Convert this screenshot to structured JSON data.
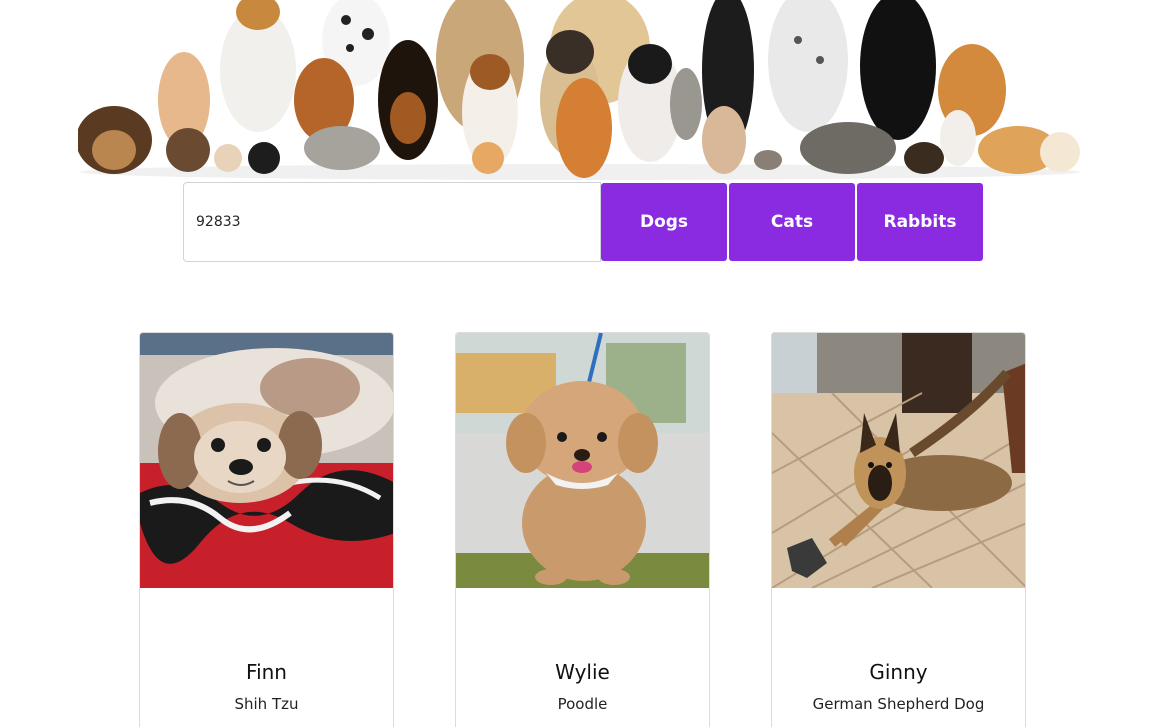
{
  "hero": {
    "image": "group-of-pets-illustration"
  },
  "search": {
    "zip_value": "92833",
    "buttons": {
      "dogs": "Dogs",
      "cats": "Cats",
      "rabbits": "Rabbits"
    },
    "button_color": "#8a2be2"
  },
  "pets": [
    {
      "name": "Finn",
      "breed": "Shih Tzu",
      "photo": "shih-tzu-photo"
    },
    {
      "name": "Wylie",
      "breed": "Poodle",
      "photo": "poodle-photo"
    },
    {
      "name": "Ginny",
      "breed": "German Shepherd Dog",
      "photo": "german-shepherd-photo"
    }
  ]
}
